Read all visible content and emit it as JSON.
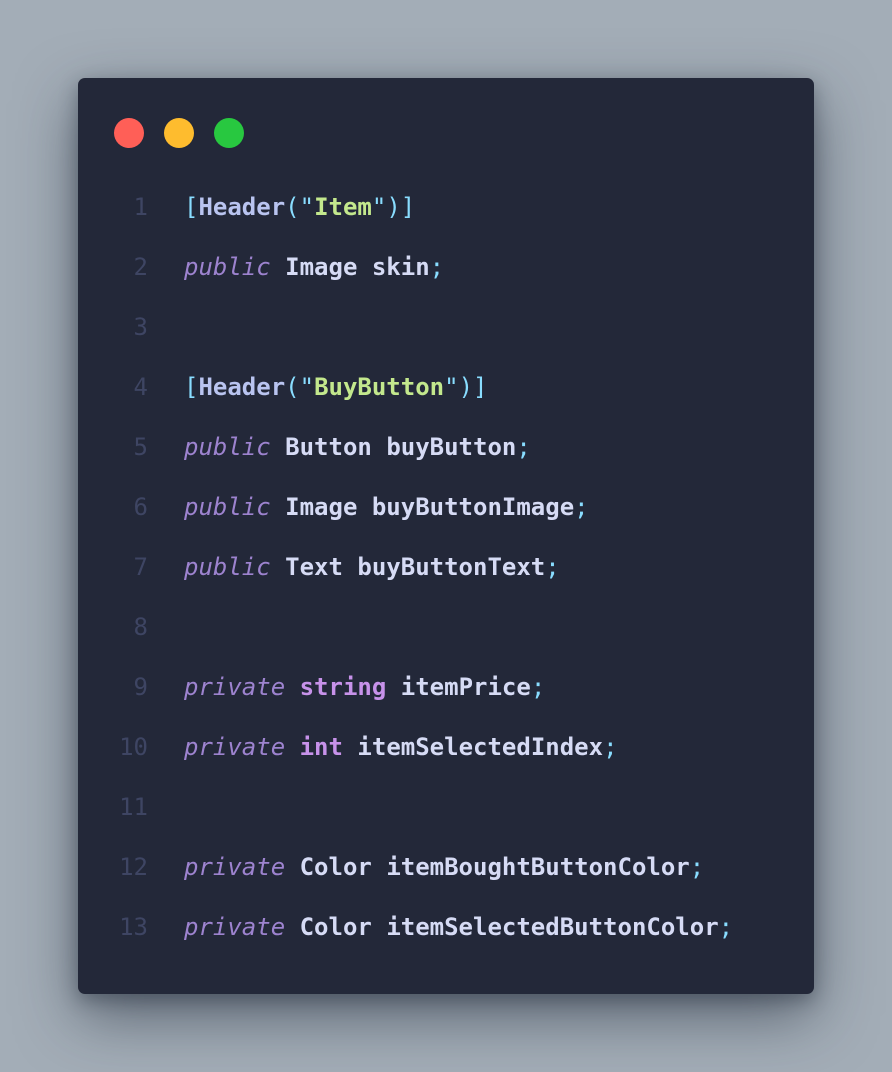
{
  "window": {
    "buttons": [
      {
        "name": "close",
        "color": "#ff5f57"
      },
      {
        "name": "minimize",
        "color": "#febc2e"
      },
      {
        "name": "zoom",
        "color": "#28c840"
      }
    ]
  },
  "code": {
    "lines": [
      {
        "n": "1",
        "tokens": [
          {
            "t": "[",
            "c": "punc"
          },
          {
            "t": "Header",
            "c": "attr"
          },
          {
            "t": "(",
            "c": "punc"
          },
          {
            "t": "\"",
            "c": "punc"
          },
          {
            "t": "Item",
            "c": "str"
          },
          {
            "t": "\"",
            "c": "punc"
          },
          {
            "t": ")]",
            "c": "punc"
          }
        ]
      },
      {
        "n": "2",
        "tokens": [
          {
            "t": "public",
            "c": "kw"
          },
          {
            "t": " ",
            "c": "plain"
          },
          {
            "t": "Image",
            "c": "cls"
          },
          {
            "t": " ",
            "c": "plain"
          },
          {
            "t": "skin",
            "c": "id"
          },
          {
            "t": ";",
            "c": "punc"
          }
        ]
      },
      {
        "n": "3",
        "tokens": []
      },
      {
        "n": "4",
        "tokens": [
          {
            "t": "[",
            "c": "punc"
          },
          {
            "t": "Header",
            "c": "attr"
          },
          {
            "t": "(",
            "c": "punc"
          },
          {
            "t": "\"",
            "c": "punc"
          },
          {
            "t": "BuyButton",
            "c": "str"
          },
          {
            "t": "\"",
            "c": "punc"
          },
          {
            "t": ")]",
            "c": "punc"
          }
        ]
      },
      {
        "n": "5",
        "tokens": [
          {
            "t": "public",
            "c": "kw"
          },
          {
            "t": " ",
            "c": "plain"
          },
          {
            "t": "Button",
            "c": "cls"
          },
          {
            "t": " ",
            "c": "plain"
          },
          {
            "t": "buyButton",
            "c": "id"
          },
          {
            "t": ";",
            "c": "punc"
          }
        ]
      },
      {
        "n": "6",
        "tokens": [
          {
            "t": "public",
            "c": "kw"
          },
          {
            "t": " ",
            "c": "plain"
          },
          {
            "t": "Image",
            "c": "cls"
          },
          {
            "t": " ",
            "c": "plain"
          },
          {
            "t": "buyButtonImage",
            "c": "id"
          },
          {
            "t": ";",
            "c": "punc"
          }
        ]
      },
      {
        "n": "7",
        "tokens": [
          {
            "t": "public",
            "c": "kw"
          },
          {
            "t": " ",
            "c": "plain"
          },
          {
            "t": "Text",
            "c": "cls"
          },
          {
            "t": " ",
            "c": "plain"
          },
          {
            "t": "buyButtonText",
            "c": "id"
          },
          {
            "t": ";",
            "c": "punc"
          }
        ]
      },
      {
        "n": "8",
        "tokens": []
      },
      {
        "n": "9",
        "tokens": [
          {
            "t": "private",
            "c": "kw"
          },
          {
            "t": " ",
            "c": "plain"
          },
          {
            "t": "string",
            "c": "type"
          },
          {
            "t": " ",
            "c": "plain"
          },
          {
            "t": "itemPrice",
            "c": "id"
          },
          {
            "t": ";",
            "c": "punc"
          }
        ]
      },
      {
        "n": "10",
        "tokens": [
          {
            "t": "private",
            "c": "kw"
          },
          {
            "t": " ",
            "c": "plain"
          },
          {
            "t": "int",
            "c": "type"
          },
          {
            "t": " ",
            "c": "plain"
          },
          {
            "t": "itemSelectedIndex",
            "c": "id"
          },
          {
            "t": ";",
            "c": "punc"
          }
        ]
      },
      {
        "n": "11",
        "tokens": []
      },
      {
        "n": "12",
        "tokens": [
          {
            "t": "private",
            "c": "kw"
          },
          {
            "t": " ",
            "c": "plain"
          },
          {
            "t": "Color",
            "c": "cls"
          },
          {
            "t": " ",
            "c": "plain"
          },
          {
            "t": "itemBoughtButtonColor",
            "c": "id"
          },
          {
            "t": ";",
            "c": "punc"
          }
        ]
      },
      {
        "n": "13",
        "tokens": [
          {
            "t": "private",
            "c": "kw"
          },
          {
            "t": " ",
            "c": "plain"
          },
          {
            "t": "Color",
            "c": "cls"
          },
          {
            "t": " ",
            "c": "plain"
          },
          {
            "t": "itemSelectedButtonColor",
            "c": "id"
          },
          {
            "t": ";",
            "c": "punc"
          }
        ]
      }
    ]
  }
}
